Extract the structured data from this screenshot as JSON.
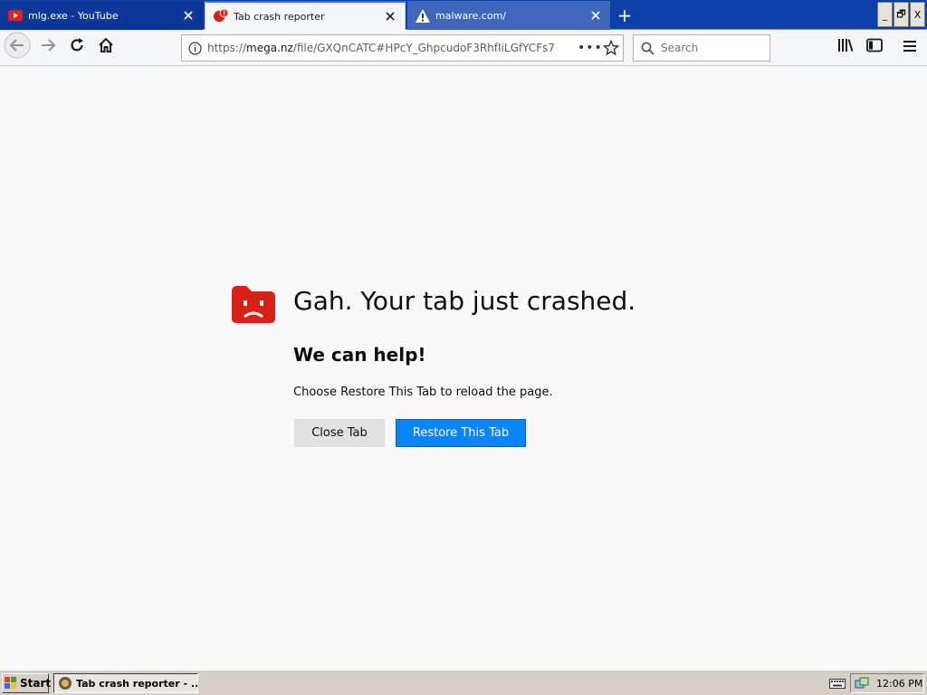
{
  "tabs": [
    {
      "title": "mlg.exe - YouTube",
      "favicon": "youtube-icon"
    },
    {
      "title": "Tab crash reporter",
      "favicon": "crash-reporter-icon"
    },
    {
      "title": "malware.com/",
      "favicon": "warning-icon"
    }
  ],
  "new_tab": "+",
  "window_controls": {
    "minimize": "_",
    "restore": "🗗",
    "close": "X"
  },
  "navbar": {
    "url_prefix": "https://",
    "url_host": "mega.nz",
    "url_path": "/file/GXQnCATC#HPcY_GhpcudoF3RhfIiLGfYCFs7",
    "page_actions": "•••",
    "search_placeholder": "Search"
  },
  "content": {
    "title": "Gah. Your tab just crashed.",
    "help_heading": "We can help!",
    "message": "Choose Restore This Tab to reload the page.",
    "close_button": "Close Tab",
    "restore_button": "Restore This Tab"
  },
  "taskbar": {
    "start_label": "Start",
    "task_label": "Tab crash reporter - ...",
    "clock": "12:06 PM"
  },
  "colors": {
    "accent": "#0a84ff",
    "crash_icon": "#d92215",
    "tabstrip": "#0c3fa8"
  }
}
